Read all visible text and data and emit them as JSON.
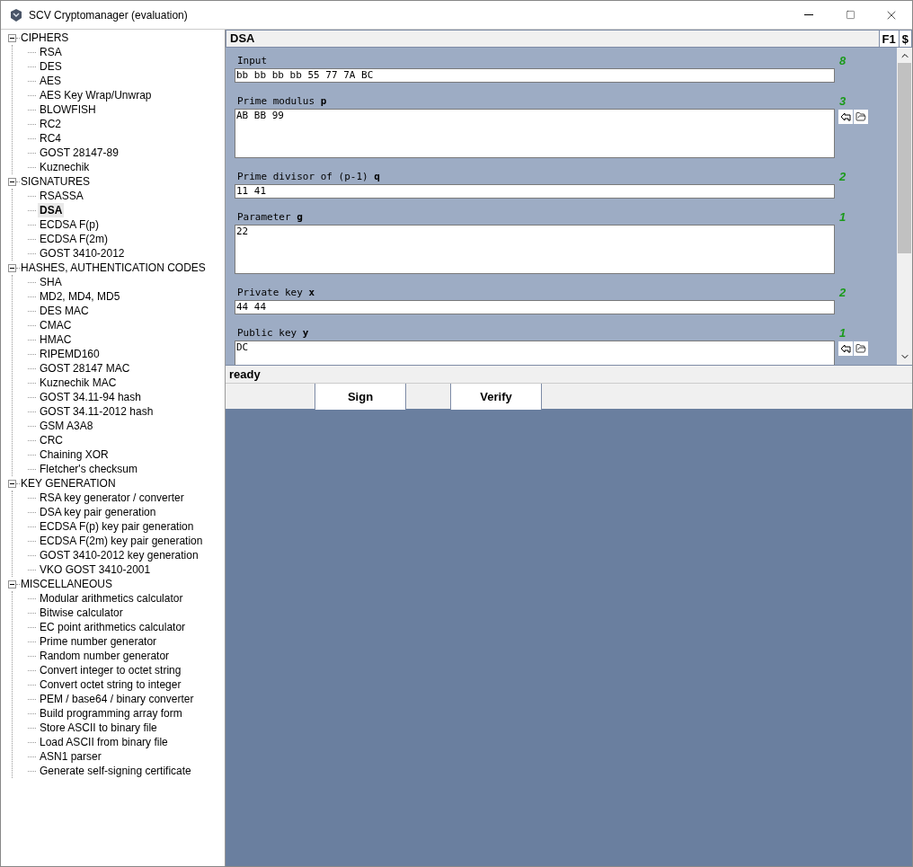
{
  "window": {
    "title": "SCV Cryptomanager (evaluation)"
  },
  "tree": [
    {
      "label": "CIPHERS",
      "expanded": true,
      "children": [
        {
          "label": "RSA",
          "selected": false
        },
        {
          "label": "DES",
          "selected": false
        },
        {
          "label": "AES",
          "selected": false
        },
        {
          "label": "AES Key Wrap/Unwrap",
          "selected": false
        },
        {
          "label": "BLOWFISH",
          "selected": false
        },
        {
          "label": "RC2",
          "selected": false
        },
        {
          "label": "RC4",
          "selected": false
        },
        {
          "label": "GOST 28147-89",
          "selected": false
        },
        {
          "label": "Kuznechik",
          "selected": false
        }
      ]
    },
    {
      "label": "SIGNATURES",
      "expanded": true,
      "children": [
        {
          "label": "RSASSA",
          "selected": false
        },
        {
          "label": "DSA",
          "selected": true
        },
        {
          "label": "ECDSA F(p)",
          "selected": false
        },
        {
          "label": "ECDSA F(2m)",
          "selected": false
        },
        {
          "label": "GOST 3410-2012",
          "selected": false
        }
      ]
    },
    {
      "label": "HASHES, AUTHENTICATION CODES",
      "expanded": true,
      "children": [
        {
          "label": "SHA",
          "selected": false
        },
        {
          "label": "MD2, MD4, MD5",
          "selected": false
        },
        {
          "label": "DES MAC",
          "selected": false
        },
        {
          "label": "CMAC",
          "selected": false
        },
        {
          "label": "HMAC",
          "selected": false
        },
        {
          "label": "RIPEMD160",
          "selected": false
        },
        {
          "label": "GOST 28147 MAC",
          "selected": false
        },
        {
          "label": "Kuznechik MAC",
          "selected": false
        },
        {
          "label": "GOST 34.11-94 hash",
          "selected": false
        },
        {
          "label": "GOST 34.11-2012 hash",
          "selected": false
        },
        {
          "label": "GSM A3A8",
          "selected": false
        },
        {
          "label": "CRC",
          "selected": false
        },
        {
          "label": "Chaining XOR",
          "selected": false
        },
        {
          "label": "Fletcher's checksum",
          "selected": false
        }
      ]
    },
    {
      "label": "KEY GENERATION",
      "expanded": true,
      "children": [
        {
          "label": "RSA key generator / converter",
          "selected": false
        },
        {
          "label": "DSA key pair generation",
          "selected": false
        },
        {
          "label": "ECDSA F(p) key pair generation",
          "selected": false
        },
        {
          "label": "ECDSA F(2m) key pair generation",
          "selected": false
        },
        {
          "label": "GOST 3410-2012 key generation",
          "selected": false
        },
        {
          "label": "VKO GOST 3410-2001",
          "selected": false
        }
      ]
    },
    {
      "label": "MISCELLANEOUS",
      "expanded": true,
      "children": [
        {
          "label": "Modular arithmetics calculator",
          "selected": false
        },
        {
          "label": "Bitwise calculator",
          "selected": false
        },
        {
          "label": "EC point arithmetics calculator",
          "selected": false
        },
        {
          "label": "Prime number generator",
          "selected": false
        },
        {
          "label": "Random number generator",
          "selected": false
        },
        {
          "label": "Convert integer to octet string",
          "selected": false
        },
        {
          "label": "Convert octet string to integer",
          "selected": false
        },
        {
          "label": "PEM / base64 / binary converter",
          "selected": false
        },
        {
          "label": "Build programming array form",
          "selected": false
        },
        {
          "label": "Store ASCII to binary file",
          "selected": false
        },
        {
          "label": "Load ASCII from binary file",
          "selected": false
        },
        {
          "label": "ASN1 parser",
          "selected": false
        },
        {
          "label": "Generate self-signing certificate",
          "selected": false
        }
      ]
    }
  ],
  "panel": {
    "title": "DSA",
    "help_buttons": [
      "F1",
      "$"
    ]
  },
  "fields": [
    {
      "label": "Input",
      "count": "8",
      "value": "bb bb bb bb 55 77 7A BC",
      "kind": "single",
      "file_buttons": false
    },
    {
      "label": "Prime modulus **p**",
      "count": "3",
      "value": "AB BB 99",
      "kind": "multi",
      "file_buttons": true
    },
    {
      "label": "Prime divisor of (p-1) **q**",
      "count": "2",
      "value": "11 41",
      "kind": "single",
      "file_buttons": false
    },
    {
      "label": "Parameter **g**",
      "count": "1",
      "value": "22",
      "kind": "multi",
      "file_buttons": false
    },
    {
      "label": "Private key **x**",
      "count": "2",
      "value": "44 44",
      "kind": "single",
      "file_buttons": false
    },
    {
      "label": "Public key **y**",
      "count": "1",
      "value": "DC",
      "kind": "multi",
      "file_buttons": true
    }
  ],
  "status": "ready",
  "actions": [
    "Sign",
    "Verify"
  ]
}
